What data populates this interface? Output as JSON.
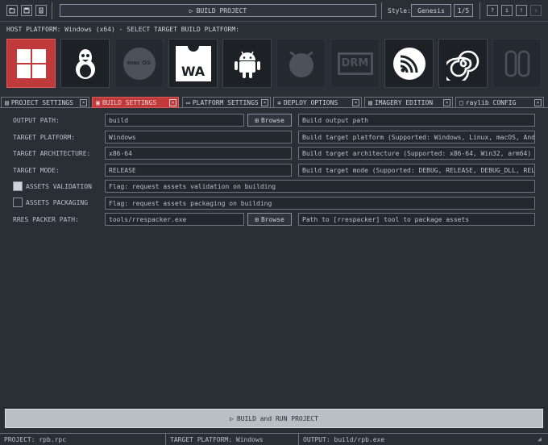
{
  "toolbar": {
    "build_project_label": "BUILD PROJECT",
    "style_label": "Style:",
    "style_value": "Genesis",
    "style_page": "1/5",
    "help_icon": "?",
    "info_icon": "i",
    "warning_icon": "!"
  },
  "host_platform_text": "HOST PLATFORM: Windows (x64) - SELECT TARGET BUILD PLATFORM:",
  "platforms": [
    {
      "name": "windows",
      "label": ""
    },
    {
      "name": "linux",
      "label": ""
    },
    {
      "name": "macos",
      "label": "mac OS"
    },
    {
      "name": "webassembly",
      "label": "WA"
    },
    {
      "name": "android",
      "label": ""
    },
    {
      "name": "freebsd",
      "label": ""
    },
    {
      "name": "drm",
      "label": "DRM"
    },
    {
      "name": "esp32",
      "label": ""
    },
    {
      "name": "raspberry",
      "label": ""
    },
    {
      "name": "switch",
      "label": ""
    }
  ],
  "tabs": [
    {
      "label": "PROJECT SETTINGS"
    },
    {
      "label": "BUILD SETTINGS"
    },
    {
      "label": "PLATFORM SETTINGS"
    },
    {
      "label": "DEPLOY OPTIONS"
    },
    {
      "label": "IMAGERY EDITION"
    },
    {
      "label": "raylib CONFIG"
    }
  ],
  "form": {
    "output_path": {
      "label": "OUTPUT PATH:",
      "value": "build",
      "browse": "Browse",
      "help": "Build output path"
    },
    "target_platform": {
      "label": "TARGET PLATFORM:",
      "value": "Windows",
      "help": "Build target platform (Supported: Windows, Linux, macOS, Android, ..."
    },
    "target_arch": {
      "label": "TARGET ARCHITECTURE:",
      "value": "x86-64",
      "help": "Build target architecture (Supported: x86-64, Win32, arm64)"
    },
    "target_mode": {
      "label": "TARGET MODE:",
      "value": "RELEASE",
      "help": "Build target mode (Supported: DEBUG, RELEASE, DEBUG_DLL, RELEASE_D..."
    },
    "assets_validation": {
      "label": "ASSETS VALIDATION",
      "help": "Flag: request assets validation on building"
    },
    "assets_packaging": {
      "label": "ASSETS PACKAGING",
      "help": "Flag: request assets packaging on building"
    },
    "rres_packer": {
      "label": "RRES PACKER PATH:",
      "value": "tools/rrespacker.exe",
      "browse": "Browse",
      "help": "Path to [rrespacker] tool to package assets"
    }
  },
  "build_run_label": "BUILD and RUN PROJECT",
  "status": {
    "project": "PROJECT: rpb.rpc",
    "platform": "TARGET PLATFORM: Windows",
    "output": "OUTPUT: build/rpb.exe"
  },
  "colors": {
    "accent": "#c0393b",
    "background": "#2a2f36"
  }
}
